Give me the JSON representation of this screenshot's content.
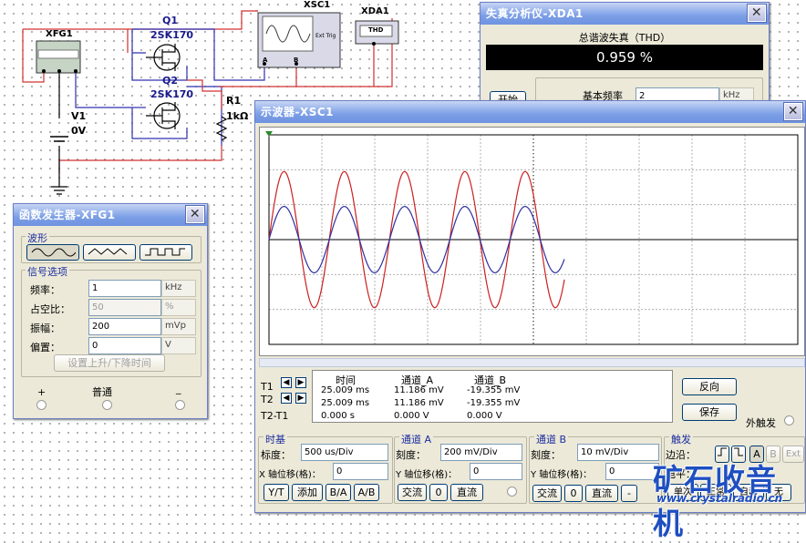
{
  "schematic": {
    "xfg1_label": "XFG1",
    "xsc1_label": "XSC1",
    "xda1_label": "XDA1",
    "xda1_chip": "THD",
    "ext_trig": "Ext Trig",
    "q1_ref": "Q1",
    "q1_model": "2SK170",
    "q2_ref": "Q2",
    "q2_model": "2SK170",
    "r1_ref": "R1",
    "r1_value": "1kΩ",
    "v1_ref": "V1",
    "v1_value": "0V",
    "a_label": "A",
    "b_label": "B"
  },
  "distortion": {
    "title": "失真分析仪-XDA1",
    "thd_label": "总谐波失真（THD）",
    "thd_value": "0.959 %",
    "start_button": "开始",
    "fund_label": "基本频率",
    "fund_value": "2",
    "fund_unit": "kHz"
  },
  "funcgen": {
    "title": "函数发生器-XFG1",
    "waveform_group": "波形",
    "signal_group": "信号选项",
    "freq_label": "频率：",
    "freq_value": "1",
    "freq_unit": "kHz",
    "duty_label": "占空比：",
    "duty_value": "50",
    "duty_unit": "%",
    "amp_label": "振幅：",
    "amp_value": "200",
    "amp_unit": "mVp",
    "offset_label": "偏置：",
    "offset_value": "0",
    "offset_unit": "V",
    "rise_button": "设置上升/下降时间",
    "plus": "+",
    "common": "普通",
    "minus": "_"
  },
  "scope": {
    "title": "示波器-XSC1",
    "t1": "T1",
    "t2": "T2",
    "t2t1": "T2-T1",
    "col_time": "时间",
    "col_a": "通道_A",
    "col_b": "通道_B",
    "rows": [
      [
        "25.009 ms",
        "11.186 mV",
        "-19.355 mV"
      ],
      [
        "25.009 ms",
        "11.186 mV",
        "-19.355 mV"
      ],
      [
        "0.000 s",
        "0.000 V",
        "0.000 V"
      ]
    ],
    "reverse_button": "反向",
    "save_button": "保存",
    "ext_trigger": "外触发",
    "timebase": {
      "title": "时基",
      "scale_label": "标度：",
      "scale_value": "500 us/Div",
      "xpos_label": "X 轴位移(格)：",
      "xpos_value": "0",
      "btn_yt": "Y/T",
      "btn_add": "添加",
      "btn_ba": "B/A",
      "btn_ab": "A/B"
    },
    "channel_a": {
      "title": "通道 A",
      "scale_label": "刻度：",
      "scale_value": "200 mV/Div",
      "ypos_label": "Y 轴位移(格)：",
      "ypos_value": "0",
      "btn_ac": "交流",
      "btn_zero": "0",
      "btn_dc": "直流"
    },
    "channel_b": {
      "title": "通道 B",
      "scale_label": "刻度：",
      "scale_value": "10 mV/Div",
      "ypos_label": "Y 轴位移(格)：",
      "ypos_value": "0",
      "btn_ac": "交流",
      "btn_zero": "0",
      "btn_dc": "直流",
      "btn_minus": "-"
    },
    "trigger": {
      "title": "触发",
      "edge_label": "边沿：",
      "btn_a": "A",
      "btn_b": "B",
      "btn_ext": "Ext",
      "level_label": "电平：",
      "mode_single": "单次",
      "mode_normal": "正常",
      "mode_auto": "自动",
      "mode_none": "无"
    }
  },
  "watermark": {
    "text": "矿石收音机",
    "url": "www.crystalradio.cn"
  },
  "colors": {
    "channel_a": "#cc2020",
    "channel_b": "#3030a0",
    "wire_red": "#d03030",
    "wire_blue": "#3030b0"
  }
}
